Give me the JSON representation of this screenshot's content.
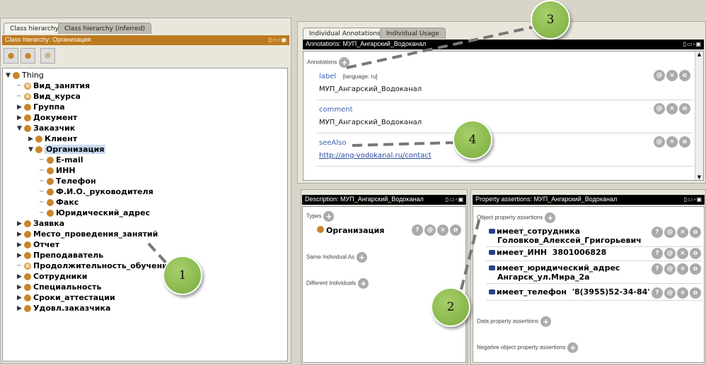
{
  "left": {
    "tabs": [
      "Class hierarchy",
      "Class hierarchy (inferred)"
    ],
    "header": "Class hierarchy: Организация",
    "toolbar": [
      "add-subclass",
      "add-sibling",
      "delete-class"
    ],
    "tree": [
      {
        "label": "Thing",
        "level": 0,
        "state": "expanded",
        "defined": false
      },
      {
        "label": "Вид_занятия",
        "level": 1,
        "state": "leaf",
        "defined": true
      },
      {
        "label": "Вид_курса",
        "level": 1,
        "state": "leaf",
        "defined": true
      },
      {
        "label": "Группа",
        "level": 1,
        "state": "collapsed",
        "defined": false
      },
      {
        "label": "Документ",
        "level": 1,
        "state": "collapsed",
        "defined": false
      },
      {
        "label": "Заказчик",
        "level": 1,
        "state": "expanded",
        "defined": false
      },
      {
        "label": "Клиент",
        "level": 2,
        "state": "collapsed",
        "defined": false
      },
      {
        "label": "Организация",
        "level": 2,
        "state": "expanded",
        "defined": false,
        "selected": true
      },
      {
        "label": "E-mail",
        "level": 3,
        "state": "leaf",
        "defined": false
      },
      {
        "label": "ИНН",
        "level": 3,
        "state": "leaf",
        "defined": false
      },
      {
        "label": "Телефон",
        "level": 3,
        "state": "leaf",
        "defined": false
      },
      {
        "label": "Ф.И.О._руководителя",
        "level": 3,
        "state": "leaf",
        "defined": false
      },
      {
        "label": "Факс",
        "level": 3,
        "state": "leaf",
        "defined": false
      },
      {
        "label": "Юридический_адрес",
        "level": 3,
        "state": "leaf",
        "defined": false
      },
      {
        "label": "Заявка",
        "level": 1,
        "state": "collapsed",
        "defined": false
      },
      {
        "label": "Место_проведения_занятий",
        "level": 1,
        "state": "collapsed",
        "defined": false
      },
      {
        "label": "Отчет",
        "level": 1,
        "state": "collapsed",
        "defined": false
      },
      {
        "label": "Преподаватель",
        "level": 1,
        "state": "collapsed",
        "defined": false
      },
      {
        "label": "Продолжительность_обучения",
        "level": 1,
        "state": "leaf",
        "defined": true
      },
      {
        "label": "Сотрудники",
        "level": 1,
        "state": "collapsed",
        "defined": false
      },
      {
        "label": "Специальность",
        "level": 1,
        "state": "collapsed",
        "defined": false
      },
      {
        "label": "Сроки_аттестации",
        "level": 1,
        "state": "collapsed",
        "defined": false
      },
      {
        "label": "Удовл.заказчика",
        "level": 1,
        "state": "collapsed",
        "defined": false
      }
    ]
  },
  "annotations": {
    "tabs": [
      "Individual Annotations",
      "Individual Usage"
    ],
    "header": "Annotations: МУП_Ангарский_Водоканал",
    "section": "Annotations",
    "items": [
      {
        "prop": "label",
        "lang": "[language: ru]",
        "value": "МУП_Ангарский_Водоканал"
      },
      {
        "prop": "comment",
        "lang": "",
        "value": "МУП_Ангарский_Водоканал"
      },
      {
        "prop": "seeAlso",
        "lang": ",",
        "value": "http://ang-vodokanal.ru/contact"
      }
    ]
  },
  "description": {
    "header": "Description: МУП_Ангарский_Водоканал",
    "types": "Types",
    "type_value": "Организация",
    "same": "Same Individual As",
    "different": "Different Individuals"
  },
  "properties": {
    "header": "Property assertions: МУП_Ангарский_Водоканал",
    "object": "Object property assertions",
    "items": [
      {
        "prop": "имеет_сотрудника",
        "value": "Головков_Алексей_Григорьевич"
      },
      {
        "prop": "имеет_ИНН",
        "value": "3801006828"
      },
      {
        "prop": "имеет_юридический_адрес",
        "value": "Ангарск_ул.Мира_2а"
      },
      {
        "prop": "имеет_телефон",
        "value": "'8(3955)52-34-84'"
      }
    ],
    "data": "Data property assertions",
    "negative": "Negative object property assertions"
  },
  "callouts": [
    "1",
    "2",
    "3",
    "4"
  ],
  "icons": {
    "at": "@",
    "x": "×",
    "o": "o",
    "q": "?",
    "plus": "+"
  }
}
